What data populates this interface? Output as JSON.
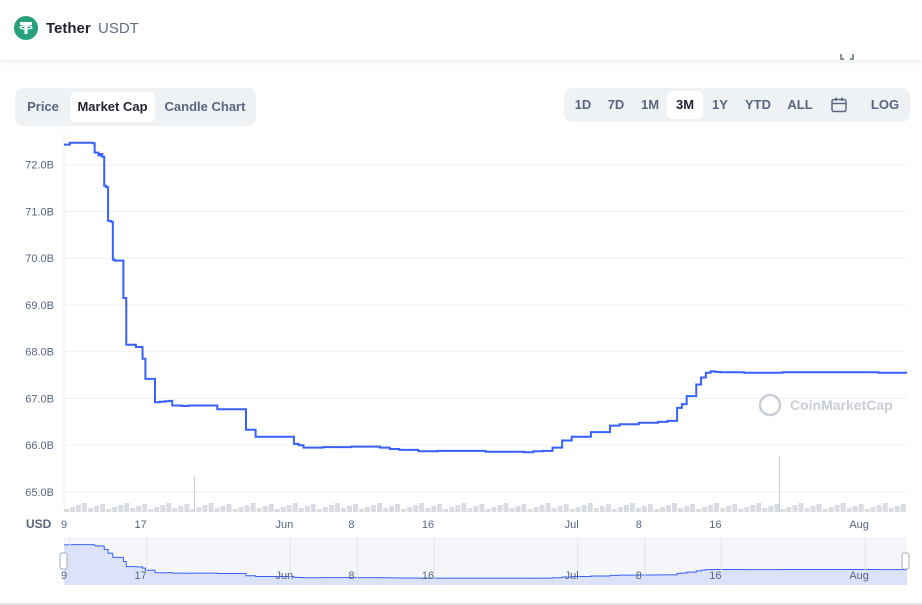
{
  "header": {
    "coin_name": "Tether",
    "coin_symbol": "USDT",
    "logo_color": "#26a17b"
  },
  "chart_tabs": [
    {
      "label": "Price",
      "active": false
    },
    {
      "label": "Market Cap",
      "active": true
    },
    {
      "label": "Candle Chart",
      "active": false
    }
  ],
  "time_ranges": [
    {
      "label": "1D",
      "active": false
    },
    {
      "label": "7D",
      "active": false
    },
    {
      "label": "1M",
      "active": false
    },
    {
      "label": "3M",
      "active": true
    },
    {
      "label": "1Y",
      "active": false
    },
    {
      "label": "YTD",
      "active": false
    },
    {
      "label": "ALL",
      "active": false
    }
  ],
  "log_label": "LOG",
  "currency_label": "USD",
  "watermark": "CoinMarketCap",
  "colors": {
    "line": "#3861fb",
    "navigator_fill": "#d7ddfb",
    "grid": "#eff2f5"
  },
  "chart_data": {
    "type": "line",
    "title": "",
    "ylabel": "",
    "ylim": [
      64.7,
      72.7
    ],
    "y_ticks": [
      "65.0B",
      "66.0B",
      "67.0B",
      "68.0B",
      "69.0B",
      "70.0B",
      "71.0B",
      "72.0B"
    ],
    "x_ticks": [
      "9",
      "17",
      "Jun",
      "8",
      "16",
      "Jul",
      "8",
      "16",
      "Aug"
    ],
    "x_tick_days": [
      0,
      8,
      23,
      30,
      38,
      53,
      60,
      68,
      83
    ],
    "navigator_ticks": [
      "9",
      "17",
      "Jun",
      "8",
      "16",
      "Jul",
      "8",
      "16",
      "Aug"
    ],
    "series": [
      {
        "x": [
          0,
          0.6,
          3,
          3.2,
          3.6,
          3.8,
          4,
          4.2,
          4.4,
          4.6,
          4.9,
          5.1,
          5.3,
          6.2,
          6.5,
          7.5,
          8.2,
          8.5,
          9.5,
          10,
          10.5,
          11,
          11.3,
          12.3,
          13,
          15,
          16,
          19,
          20,
          20.5,
          24,
          24.5,
          25,
          27,
          30,
          33,
          34,
          35,
          37,
          39,
          44,
          48,
          49,
          50,
          51,
          52,
          53,
          55,
          57,
          58,
          60,
          62,
          63,
          64,
          64.5,
          65,
          66,
          66.5,
          67,
          67.5,
          68,
          68.5,
          71,
          75,
          80,
          85,
          88
        ],
        "values": [
          72.43,
          72.47,
          72.46,
          72.26,
          72.2,
          72.23,
          72.17,
          71.55,
          71.52,
          70.8,
          70.78,
          69.97,
          69.95,
          69.15,
          68.15,
          68.1,
          67.85,
          67.42,
          66.92,
          66.93,
          66.94,
          66.95,
          66.85,
          66.84,
          66.85,
          66.85,
          66.77,
          66.33,
          66.18,
          66.18,
          66.03,
          66.0,
          65.95,
          65.96,
          65.97,
          65.95,
          65.92,
          65.9,
          65.87,
          65.88,
          65.86,
          65.85,
          65.87,
          65.88,
          65.95,
          66.1,
          66.18,
          66.28,
          66.42,
          66.45,
          66.48,
          66.5,
          66.52,
          66.8,
          66.88,
          67.05,
          67.3,
          67.45,
          67.55,
          67.58,
          67.57,
          67.56,
          67.55,
          67.56,
          67.56,
          67.55,
          67.55
        ]
      }
    ]
  }
}
